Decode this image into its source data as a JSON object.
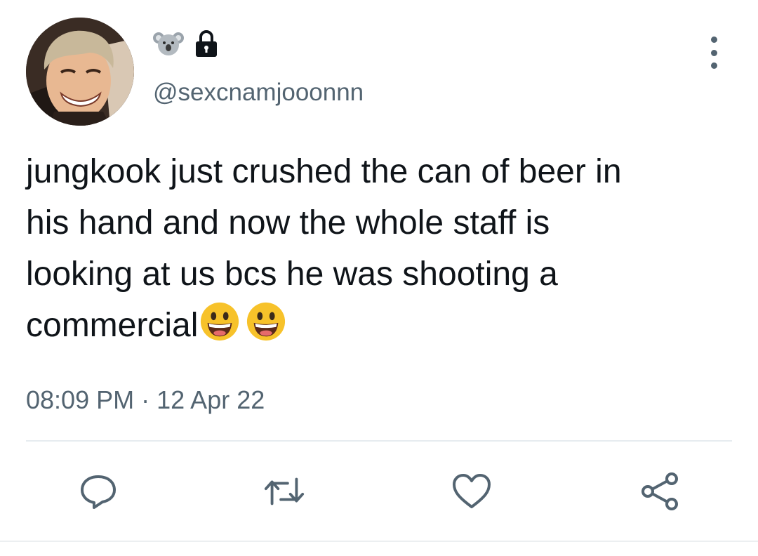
{
  "tweet": {
    "handle": "@sexcnamjooonnn",
    "name_emoji_icon": "koala-icon",
    "protected_icon": "lock-icon",
    "text_lines": [
      "jungkook just crushed the can of beer in",
      "his hand and now the whole staff is",
      "looking at us bcs he was shooting a",
      "commercial"
    ],
    "trailing_emojis": [
      "grinning-face-icon",
      "grinning-face-icon"
    ],
    "time": "08:09 PM",
    "separator": "·",
    "date": "12 Apr 22"
  },
  "actions": [
    "reply-icon",
    "retweet-icon",
    "like-icon",
    "share-icon"
  ],
  "colors": {
    "text": "#0f1419",
    "secondary": "#536471",
    "divider": "#e6ecf0",
    "emoji_yellow": "#f7c22a"
  }
}
